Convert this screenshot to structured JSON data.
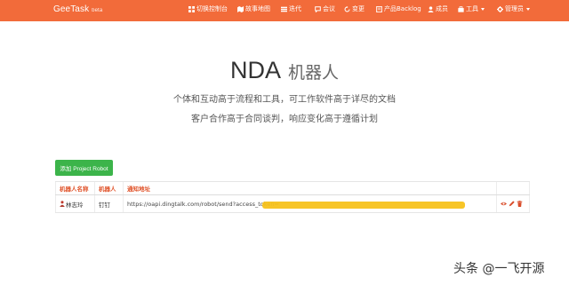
{
  "nav": {
    "brand": "GeeTask",
    "brand_badge": "beta",
    "items": [
      {
        "label": "切换控制台",
        "icon": "dashboard-icon"
      },
      {
        "label": "故事地图",
        "icon": "map-icon"
      },
      {
        "label": "迭代",
        "icon": "list-icon"
      },
      {
        "label": "会议",
        "icon": "chat-icon"
      },
      {
        "label": "变更",
        "icon": "refresh-icon"
      },
      {
        "label": "产品Backlog",
        "icon": "book-icon"
      },
      {
        "label": "成员",
        "icon": "user-icon"
      },
      {
        "label": "工具",
        "icon": "briefcase-icon"
      },
      {
        "label": "管理员",
        "icon": "gear-icon"
      }
    ]
  },
  "hero": {
    "title": "NDA",
    "subtitle": "机器人",
    "line1": "个体和互动高于流程和工具，可工作软件高于详尽的文档",
    "line2": "客户合作高于合同谈判，响应变化高于遵循计划"
  },
  "add_button": "添加 Project Robot",
  "table": {
    "headers": [
      "机器人名称",
      "机器人",
      "通知地址"
    ],
    "rows": [
      {
        "name": "林志玲",
        "type": "钉钉",
        "url": "https://oapi.dingtalk.com/robot/send?access_token="
      }
    ]
  },
  "watermark": "头条 @一飞开源",
  "colors": {
    "nav_bg": "#f26b3a",
    "button_green": "#3cb44a",
    "header_text": "#e0532a",
    "redaction": "#f7c21b"
  }
}
